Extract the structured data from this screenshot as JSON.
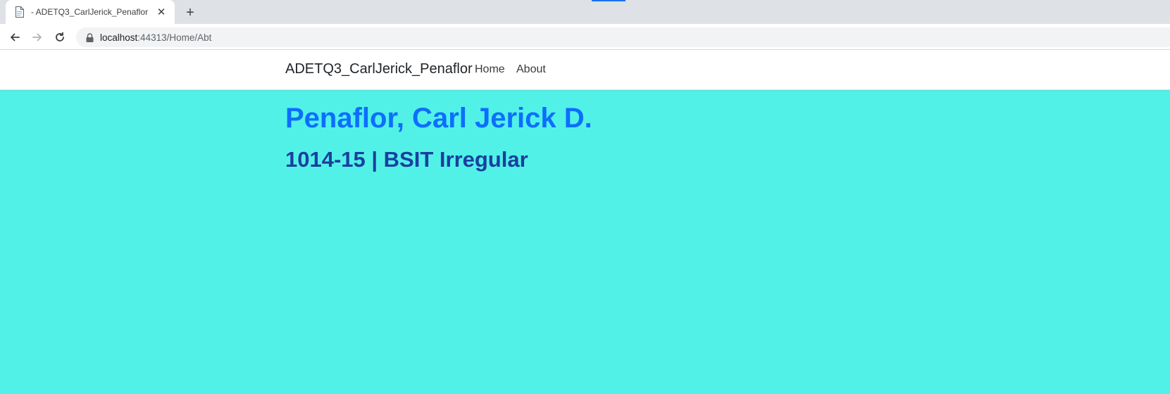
{
  "browser": {
    "tab": {
      "title": "- ADETQ3_CarlJerick_Penaflor",
      "favicon": "document-icon",
      "close_icon": "close-icon"
    },
    "new_tab_icon": "plus-icon",
    "nav": {
      "back_icon": "arrow-left-icon",
      "forward_icon": "arrow-right-icon",
      "reload_icon": "reload-icon"
    },
    "address": {
      "host": "localhost",
      "path": ":44313/Home/Abt",
      "lock_icon": "lock-icon"
    }
  },
  "site": {
    "brand": "ADETQ3_CarlJerick_Penaflor",
    "nav_links": [
      "Home",
      "About"
    ]
  },
  "content": {
    "name": "Penaflor, Carl Jerick D.",
    "details": "1014-15 | BSIT Irregular"
  },
  "colors": {
    "page_background": "#52f1e8",
    "heading_primary": "#0d6efd",
    "heading_secondary": "#1a3f9e",
    "tab_strip": "#dee1e6"
  }
}
